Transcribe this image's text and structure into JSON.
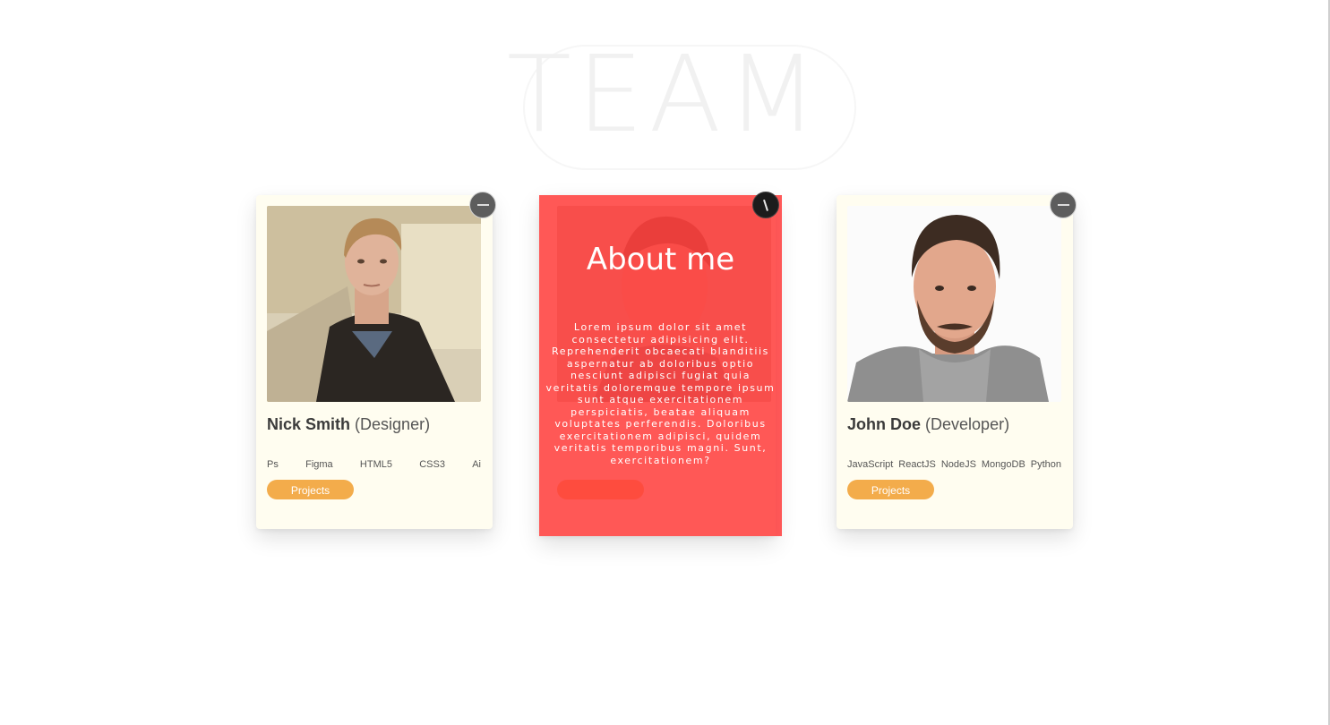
{
  "page": {
    "title": "TEAM"
  },
  "cards": [
    {
      "name": "Nick Smith",
      "role": "(Designer)",
      "skills": [
        "Ps",
        "Figma",
        "HTML5",
        "CSS3",
        "Ai"
      ],
      "button": "Projects",
      "toggle_icon": "minus-icon"
    },
    {
      "overlay_title": "About me",
      "overlay_text": "Lorem ipsum dolor sit amet consectetur adipisicing elit. Reprehenderit obcaecati blanditiis aspernatur ab doloribus optio nesciunt adipisci fugiat quia veritatis doloremque tempore ipsum sunt atque exercitationem perspiciatis, beatae aliquam voluptates perferendis. Doloribus exercitationem adipisci, quidem veritatis temporibus magni. Sunt, exercitationem?",
      "toggle_icon": "close-icon"
    },
    {
      "name": "John Doe",
      "role": "(Developer)",
      "skills": [
        "JavaScript",
        "ReactJS",
        "NodeJS",
        "MongoDB",
        "Python"
      ],
      "button": "Projects",
      "toggle_icon": "minus-icon"
    }
  ],
  "colors": {
    "card_bg": "#fffdf0",
    "button": "#f3ac4b",
    "overlay": "#ff4a4a",
    "toggle": "#5d5d5d"
  }
}
